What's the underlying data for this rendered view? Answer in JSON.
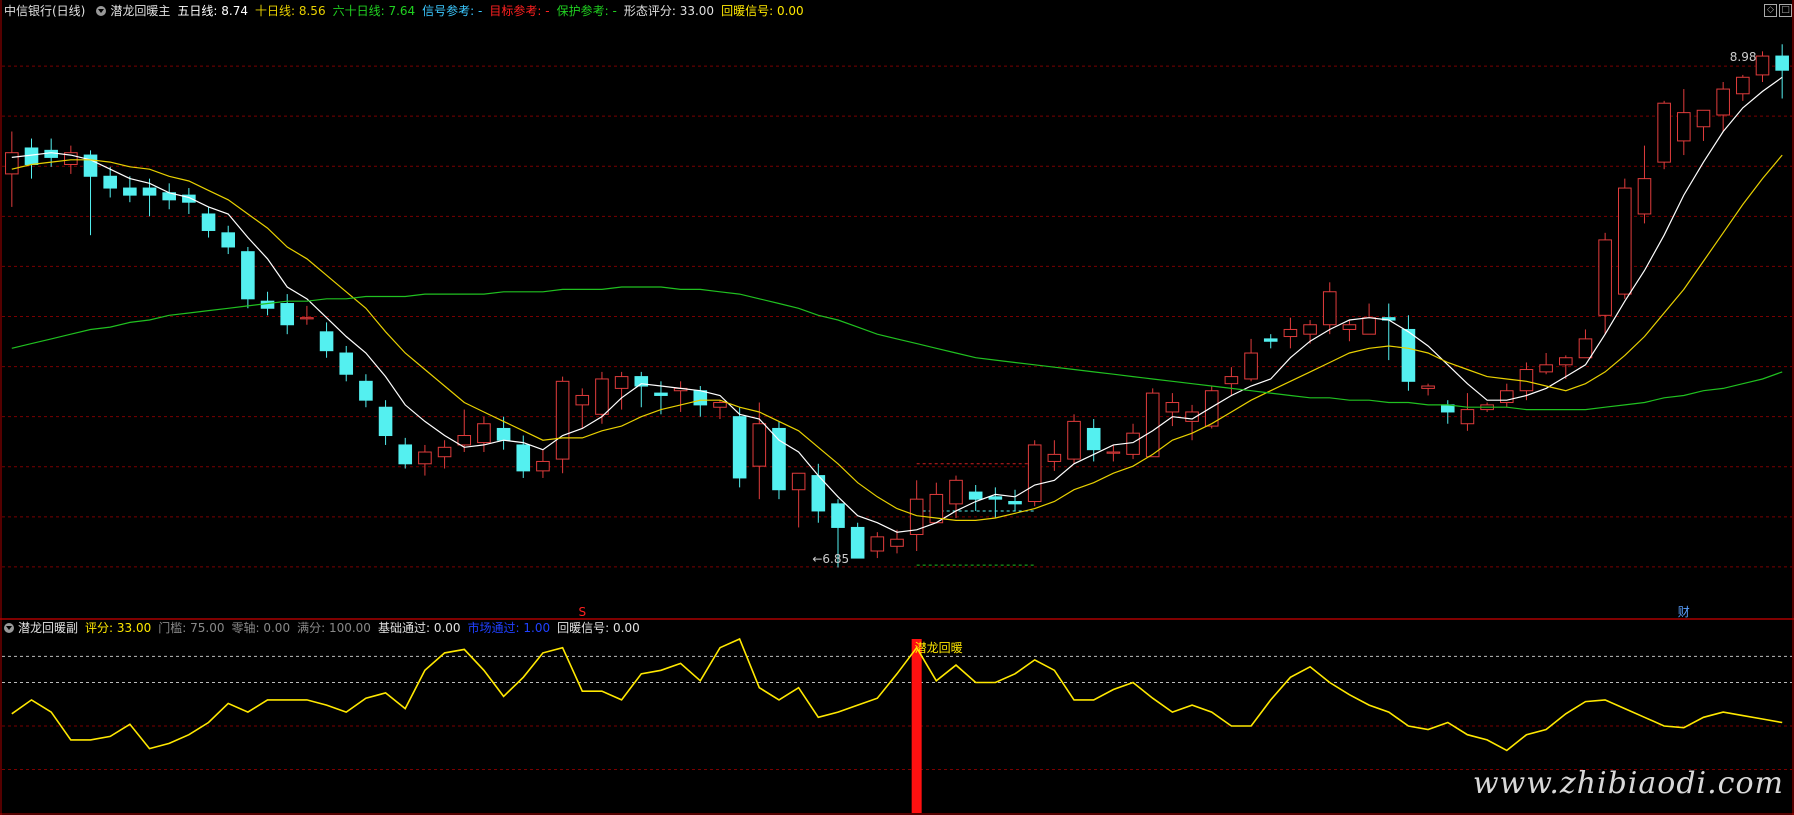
{
  "colors": {
    "bg": "#000000",
    "grid": "#7a0000",
    "frame": "#aa0000",
    "up": "#e03c3c",
    "down": "#54f0f0",
    "ma5": "#ffffff",
    "ma10": "#e8d000",
    "ma60": "#20c020",
    "osc": "#ffe800",
    "signal": "#ff1010"
  },
  "top_header": {
    "stock": "中信银行(日线)",
    "indicator": "潜龙回暖主",
    "ma5_label": "五日线:",
    "ma5_value": "8.74",
    "ma10_label": "十日线:",
    "ma10_value": "8.56",
    "ma60_label": "六十日线:",
    "ma60_value": "7.64",
    "signal_ref_label": "信号参考:",
    "signal_ref_value": "-",
    "target_ref_label": "目标参考:",
    "target_ref_value": "-",
    "protect_ref_label": "保护参考:",
    "protect_ref_value": "-",
    "score_label": "形态评分:",
    "score_value": "33.00",
    "warm_label": "回暖信号:",
    "warm_value": "0.00"
  },
  "bottom_header": {
    "indicator": "潜龙回暖副",
    "score_label": "评分:",
    "score_value": "33.00",
    "threshold_label": "门槛:",
    "threshold_value": "75.00",
    "zero_label": "零轴:",
    "zero_value": "0.00",
    "full_label": "满分:",
    "full_value": "100.00",
    "base_label": "基础通过:",
    "base_value": "0.00",
    "market_label": "市场通过:",
    "market_value": "1.00",
    "warm_label": "回暖信号:",
    "warm_value": "0.00"
  },
  "window_controls": [
    "◇",
    "□"
  ],
  "watermark": "www.zhibiaodi.com",
  "chart_data": [
    {
      "type": "candlestick",
      "ylim": [
        6.6,
        9.15
      ],
      "annotations": [
        {
          "text": "8.98",
          "bar": 89,
          "value": 8.98
        },
        {
          "text": "←6.85",
          "bar": 41,
          "value": 6.85
        },
        {
          "text": "S",
          "bar": 29,
          "value": 6.62
        },
        {
          "text": "财",
          "bar": 85,
          "value": 6.62
        }
      ],
      "reference_lines": [
        {
          "from_bar": 46,
          "to_bar": 52,
          "value": 7.25,
          "color": "#d02020"
        },
        {
          "from_bar": 46,
          "to_bar": 52,
          "value": 7.05,
          "color": "#54f0f0"
        },
        {
          "from_bar": 46,
          "to_bar": 52,
          "value": 6.82,
          "color": "#20c020"
        }
      ],
      "ohlc": [
        [
          8.48,
          8.66,
          8.34,
          8.57
        ],
        [
          8.59,
          8.63,
          8.46,
          8.52
        ],
        [
          8.58,
          8.63,
          8.51,
          8.55
        ],
        [
          8.52,
          8.6,
          8.48,
          8.57
        ],
        [
          8.56,
          8.58,
          8.22,
          8.47
        ],
        [
          8.47,
          8.51,
          8.38,
          8.42
        ],
        [
          8.42,
          8.47,
          8.36,
          8.39
        ],
        [
          8.42,
          8.46,
          8.3,
          8.39
        ],
        [
          8.4,
          8.44,
          8.33,
          8.37
        ],
        [
          8.39,
          8.42,
          8.31,
          8.36
        ],
        [
          8.31,
          8.34,
          8.21,
          8.24
        ],
        [
          8.23,
          8.26,
          8.14,
          8.17
        ],
        [
          8.15,
          8.17,
          7.91,
          7.95
        ],
        [
          7.94,
          7.98,
          7.88,
          7.91
        ],
        [
          7.93,
          7.97,
          7.8,
          7.84
        ],
        [
          7.87,
          7.92,
          7.84,
          7.87
        ],
        [
          7.81,
          7.85,
          7.7,
          7.73
        ],
        [
          7.72,
          7.75,
          7.6,
          7.63
        ],
        [
          7.6,
          7.63,
          7.49,
          7.52
        ],
        [
          7.49,
          7.52,
          7.33,
          7.37
        ],
        [
          7.33,
          7.36,
          7.23,
          7.25
        ],
        [
          7.25,
          7.33,
          7.2,
          7.3
        ],
        [
          7.28,
          7.35,
          7.23,
          7.32
        ],
        [
          7.33,
          7.48,
          7.3,
          7.37
        ],
        [
          7.34,
          7.45,
          7.3,
          7.42
        ],
        [
          7.4,
          7.45,
          7.31,
          7.35
        ],
        [
          7.33,
          7.37,
          7.19,
          7.22
        ],
        [
          7.22,
          7.31,
          7.19,
          7.26
        ],
        [
          7.27,
          7.62,
          7.21,
          7.6
        ],
        [
          7.5,
          7.57,
          7.4,
          7.54
        ],
        [
          7.46,
          7.64,
          7.42,
          7.61
        ],
        [
          7.57,
          7.64,
          7.48,
          7.62
        ],
        [
          7.62,
          7.64,
          7.49,
          7.58
        ],
        [
          7.55,
          7.6,
          7.46,
          7.54
        ],
        [
          7.56,
          7.6,
          7.47,
          7.57
        ],
        [
          7.56,
          7.58,
          7.45,
          7.5
        ],
        [
          7.49,
          7.52,
          7.44,
          7.51
        ],
        [
          7.45,
          7.49,
          7.15,
          7.19
        ],
        [
          7.24,
          7.51,
          7.1,
          7.42
        ],
        [
          7.4,
          7.43,
          7.1,
          7.14
        ],
        [
          7.14,
          7.2,
          6.98,
          7.21
        ],
        [
          7.2,
          7.25,
          7.0,
          7.05
        ],
        [
          7.08,
          7.1,
          6.81,
          6.98
        ],
        [
          6.98,
          7.0,
          6.85,
          6.85
        ],
        [
          6.88,
          6.96,
          6.85,
          6.94
        ],
        [
          6.9,
          6.97,
          6.87,
          6.93
        ],
        [
          6.95,
          7.18,
          6.88,
          7.1
        ],
        [
          7.0,
          7.17,
          7.0,
          7.12
        ],
        [
          7.08,
          7.2,
          7.02,
          7.18
        ],
        [
          7.13,
          7.16,
          7.05,
          7.1
        ],
        [
          7.11,
          7.15,
          7.02,
          7.1
        ],
        [
          7.09,
          7.14,
          7.05,
          7.08
        ],
        [
          7.09,
          7.35,
          7.07,
          7.33
        ],
        [
          7.26,
          7.35,
          7.22,
          7.29
        ],
        [
          7.27,
          7.46,
          7.25,
          7.43
        ],
        [
          7.4,
          7.44,
          7.26,
          7.31
        ],
        [
          7.3,
          7.33,
          7.26,
          7.3
        ],
        [
          7.29,
          7.42,
          7.27,
          7.38
        ],
        [
          7.28,
          7.57,
          7.28,
          7.55
        ],
        [
          7.47,
          7.55,
          7.41,
          7.51
        ],
        [
          7.43,
          7.5,
          7.35,
          7.47
        ],
        [
          7.41,
          7.58,
          7.4,
          7.56
        ],
        [
          7.59,
          7.66,
          7.54,
          7.62
        ],
        [
          7.61,
          7.78,
          7.6,
          7.72
        ],
        [
          7.78,
          7.8,
          7.74,
          7.77
        ],
        [
          7.79,
          7.87,
          7.74,
          7.82
        ],
        [
          7.8,
          7.86,
          7.76,
          7.84
        ],
        [
          7.84,
          8.02,
          7.8,
          7.98
        ],
        [
          7.82,
          7.86,
          7.77,
          7.84
        ],
        [
          7.8,
          7.93,
          7.8,
          7.87
        ],
        [
          7.87,
          7.93,
          7.69,
          7.86
        ],
        [
          7.82,
          7.88,
          7.56,
          7.6
        ],
        [
          7.57,
          7.59,
          7.54,
          7.58
        ],
        [
          7.5,
          7.52,
          7.42,
          7.47
        ],
        [
          7.42,
          7.55,
          7.39,
          7.48
        ],
        [
          7.48,
          7.51,
          7.47,
          7.5
        ],
        [
          7.51,
          7.59,
          7.49,
          7.56
        ],
        [
          7.56,
          7.68,
          7.52,
          7.65
        ],
        [
          7.64,
          7.72,
          7.63,
          7.67
        ],
        [
          7.67,
          7.71,
          7.61,
          7.7
        ],
        [
          7.7,
          7.82,
          7.7,
          7.78
        ],
        [
          7.88,
          8.23,
          7.8,
          8.2
        ],
        [
          7.97,
          8.46,
          7.95,
          8.42
        ],
        [
          8.31,
          8.6,
          8.27,
          8.46
        ],
        [
          8.53,
          8.79,
          8.5,
          8.78
        ],
        [
          8.62,
          8.84,
          8.56,
          8.74
        ],
        [
          8.68,
          8.75,
          8.62,
          8.75
        ],
        [
          8.73,
          8.87,
          8.66,
          8.84
        ],
        [
          8.82,
          8.9,
          8.79,
          8.89
        ],
        [
          8.9,
          9.0,
          8.87,
          8.98
        ],
        [
          8.98,
          9.03,
          8.8,
          8.92
        ]
      ],
      "series": [
        {
          "name": "五日线",
          "color": "#ffffff",
          "values": [
            8.55,
            8.56,
            8.57,
            8.56,
            8.54,
            8.5,
            8.46,
            8.44,
            8.4,
            8.38,
            8.34,
            8.31,
            8.21,
            8.12,
            8.0,
            7.95,
            7.87,
            7.79,
            7.72,
            7.62,
            7.5,
            7.43,
            7.37,
            7.32,
            7.33,
            7.35,
            7.34,
            7.31,
            7.37,
            7.4,
            7.45,
            7.53,
            7.59,
            7.58,
            7.57,
            7.56,
            7.54,
            7.46,
            7.44,
            7.35,
            7.3,
            7.2,
            7.11,
            7.03,
            7.0,
            6.96,
            6.97,
            7.0,
            7.05,
            7.09,
            7.12,
            7.11,
            7.16,
            7.18,
            7.25,
            7.29,
            7.33,
            7.34,
            7.39,
            7.45,
            7.44,
            7.49,
            7.54,
            7.58,
            7.61,
            7.7,
            7.77,
            7.82,
            7.86,
            7.87,
            7.86,
            7.81,
            7.75,
            7.67,
            7.59,
            7.52,
            7.52,
            7.54,
            7.57,
            7.62,
            7.67,
            7.8,
            7.94,
            8.07,
            8.22,
            8.39,
            8.53,
            8.66,
            8.76,
            8.83,
            8.89
          ]
        },
        {
          "name": "十日线",
          "color": "#e8d000",
          "values": [
            8.5,
            8.52,
            8.53,
            8.54,
            8.54,
            8.53,
            8.51,
            8.5,
            8.47,
            8.45,
            8.41,
            8.37,
            8.31,
            8.25,
            8.17,
            8.12,
            8.05,
            7.98,
            7.91,
            7.81,
            7.72,
            7.65,
            7.58,
            7.51,
            7.47,
            7.43,
            7.39,
            7.35,
            7.36,
            7.36,
            7.39,
            7.41,
            7.45,
            7.48,
            7.5,
            7.52,
            7.52,
            7.49,
            7.47,
            7.43,
            7.39,
            7.32,
            7.25,
            7.17,
            7.11,
            7.06,
            7.03,
            7.02,
            7.01,
            7.01,
            7.02,
            7.04,
            7.06,
            7.09,
            7.14,
            7.17,
            7.21,
            7.24,
            7.29,
            7.35,
            7.38,
            7.42,
            7.47,
            7.52,
            7.56,
            7.6,
            7.64,
            7.68,
            7.72,
            7.74,
            7.75,
            7.74,
            7.72,
            7.68,
            7.65,
            7.62,
            7.61,
            7.6,
            7.58,
            7.56,
            7.59,
            7.64,
            7.71,
            7.79,
            7.89,
            7.99,
            8.11,
            8.23,
            8.35,
            8.46,
            8.56
          ]
        },
        {
          "name": "六十日线",
          "color": "#20c020",
          "values": [
            7.74,
            7.76,
            7.78,
            7.8,
            7.82,
            7.83,
            7.85,
            7.86,
            7.88,
            7.89,
            7.9,
            7.91,
            7.92,
            7.93,
            7.94,
            7.94,
            7.95,
            7.95,
            7.96,
            7.96,
            7.96,
            7.97,
            7.97,
            7.97,
            7.97,
            7.98,
            7.98,
            7.98,
            7.99,
            7.99,
            7.99,
            8.0,
            8.0,
            8.0,
            7.99,
            7.99,
            7.98,
            7.97,
            7.95,
            7.93,
            7.91,
            7.88,
            7.86,
            7.83,
            7.8,
            7.78,
            7.76,
            7.74,
            7.72,
            7.7,
            7.69,
            7.68,
            7.67,
            7.66,
            7.65,
            7.64,
            7.63,
            7.62,
            7.61,
            7.6,
            7.59,
            7.58,
            7.57,
            7.56,
            7.55,
            7.54,
            7.53,
            7.53,
            7.52,
            7.52,
            7.51,
            7.51,
            7.5,
            7.5,
            7.49,
            7.49,
            7.49,
            7.48,
            7.48,
            7.48,
            7.48,
            7.49,
            7.5,
            7.51,
            7.53,
            7.54,
            7.56,
            7.57,
            7.59,
            7.61,
            7.64
          ]
        }
      ]
    },
    {
      "type": "line",
      "ylim": [
        0,
        100
      ],
      "threshold_lines": [
        75,
        90
      ],
      "signal_bar": 46,
      "annotations": [
        {
          "text": "潜龙回暖",
          "bar": 46,
          "value": 96
        }
      ],
      "series": [
        {
          "name": "评分",
          "color": "#ffe800",
          "values": [
            57,
            65,
            58,
            42,
            42,
            44,
            51,
            37,
            40,
            45,
            52,
            63,
            58,
            65,
            65,
            65,
            62,
            58,
            66,
            69,
            60,
            82,
            92,
            94,
            82,
            67,
            78,
            92,
            95,
            70,
            70,
            65,
            80,
            82,
            86,
            76,
            95,
            100,
            72,
            65,
            72,
            55,
            58,
            62,
            66,
            80,
            95,
            76,
            85,
            75,
            75,
            80,
            88,
            82,
            65,
            65,
            71,
            75,
            66,
            58,
            62,
            58,
            50,
            50,
            65,
            78,
            84,
            75,
            68,
            62,
            58,
            50,
            48,
            52,
            45,
            42,
            36,
            45,
            48,
            57,
            64,
            65,
            60,
            55,
            50,
            49,
            55,
            58,
            56,
            54,
            52
          ]
        }
      ]
    }
  ]
}
